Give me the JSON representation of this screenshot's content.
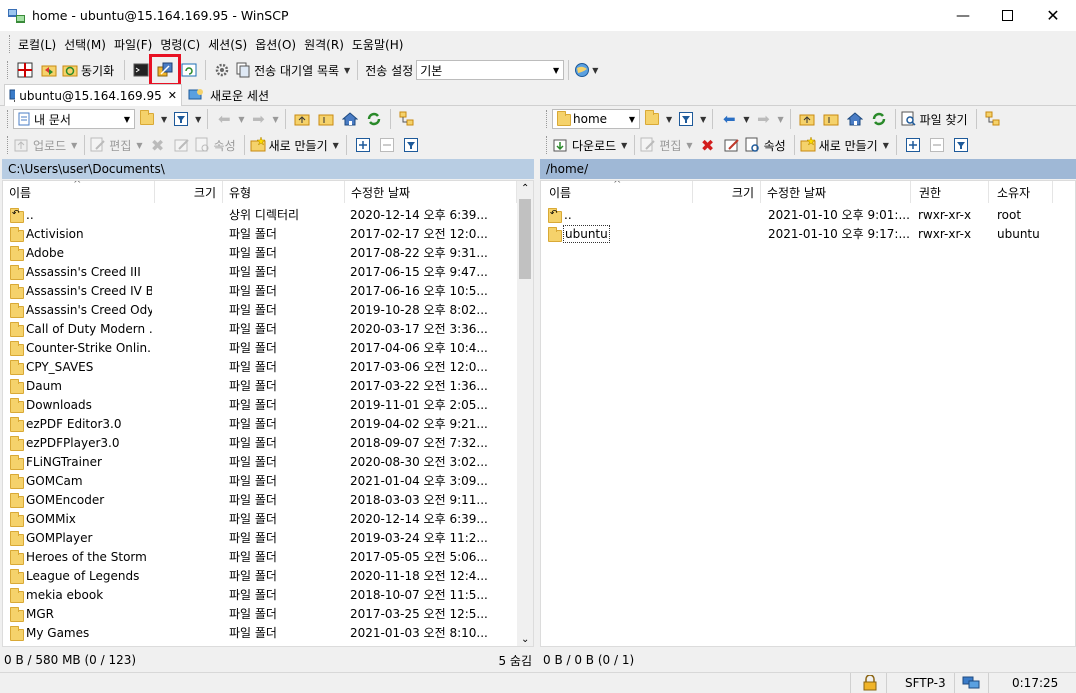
{
  "window": {
    "title": "home - ubuntu@15.164.169.95 - WinSCP"
  },
  "menu": [
    "로컬(L)",
    "선택(M)",
    "파일(F)",
    "명령(C)",
    "세션(S)",
    "옵션(O)",
    "원격(R)",
    "도움말(H)"
  ],
  "toolbar": {
    "sync_label": "동기화",
    "queue_label": "전송 대기열 목록",
    "transfer_settings_label": "전송 설정",
    "transfer_settings_value": "기본"
  },
  "tabs": {
    "session": "ubuntu@15.164.169.95",
    "new_session": "새로운 세션"
  },
  "left": {
    "location": "내 문서",
    "upload_label": "업로드",
    "edit_label": "편집",
    "properties_label": "속성",
    "new_label": "새로 만들기",
    "path": "C:\\Users\\user\\Documents\\",
    "columns": {
      "name": "이름",
      "size": "크기",
      "type": "유형",
      "modified": "수정한 날짜"
    },
    "files": [
      {
        "name": "..",
        "type": "상위 디렉터리",
        "modified": "2020-12-14  오후 6:39...",
        "parent": true
      },
      {
        "name": "Activision",
        "type": "파일 폴더",
        "modified": "2017-02-17  오전 12:0..."
      },
      {
        "name": "Adobe",
        "type": "파일 폴더",
        "modified": "2017-08-22  오후 9:31..."
      },
      {
        "name": "Assassin's Creed III",
        "type": "파일 폴더",
        "modified": "2017-06-15  오후 9:47..."
      },
      {
        "name": "Assassin's Creed IV B...",
        "type": "파일 폴더",
        "modified": "2017-06-16  오후 10:5..."
      },
      {
        "name": "Assassin's Creed Ody...",
        "type": "파일 폴더",
        "modified": "2019-10-28  오후 8:02..."
      },
      {
        "name": "Call of Duty Modern ...",
        "type": "파일 폴더",
        "modified": "2020-03-17  오전 3:36..."
      },
      {
        "name": "Counter-Strike Onlin...",
        "type": "파일 폴더",
        "modified": "2017-04-06  오후 10:4..."
      },
      {
        "name": "CPY_SAVES",
        "type": "파일 폴더",
        "modified": "2017-03-06  오전 12:0..."
      },
      {
        "name": "Daum",
        "type": "파일 폴더",
        "modified": "2017-03-22  오전 1:36..."
      },
      {
        "name": "Downloads",
        "type": "파일 폴더",
        "modified": "2019-11-01  오후 2:05..."
      },
      {
        "name": "ezPDF Editor3.0",
        "type": "파일 폴더",
        "modified": "2019-04-02  오후 9:21..."
      },
      {
        "name": "ezPDFPlayer3.0",
        "type": "파일 폴더",
        "modified": "2018-09-07  오전 7:32..."
      },
      {
        "name": "FLiNGTrainer",
        "type": "파일 폴더",
        "modified": "2020-08-30  오전 3:02..."
      },
      {
        "name": "GOMCam",
        "type": "파일 폴더",
        "modified": "2021-01-04  오후 3:09..."
      },
      {
        "name": "GOMEncoder",
        "type": "파일 폴더",
        "modified": "2018-03-03  오전 9:11..."
      },
      {
        "name": "GOMMix",
        "type": "파일 폴더",
        "modified": "2020-12-14  오후 6:39..."
      },
      {
        "name": "GOMPlayer",
        "type": "파일 폴더",
        "modified": "2019-03-24  오후 11:2..."
      },
      {
        "name": "Heroes of the Storm",
        "type": "파일 폴더",
        "modified": "2017-05-05  오전 5:06..."
      },
      {
        "name": "League of Legends",
        "type": "파일 폴더",
        "modified": "2020-11-18  오전 12:4..."
      },
      {
        "name": "mekia ebook",
        "type": "파일 폴더",
        "modified": "2018-10-07  오전 11:5..."
      },
      {
        "name": "MGR",
        "type": "파일 폴더",
        "modified": "2017-03-25  오전 12:5..."
      },
      {
        "name": "My Games",
        "type": "파일 폴더",
        "modified": "2021-01-03  오전 8:10..."
      }
    ],
    "status_left": "0 B / 580 MB (0 / 123)",
    "status_right": "5 숨김"
  },
  "right": {
    "location": "home",
    "download_label": "다운로드",
    "edit_label": "편집",
    "properties_label": "속성",
    "new_label": "새로 만들기",
    "find_label": "파일 찾기",
    "path": "/home/",
    "columns": {
      "name": "이름",
      "size": "크기",
      "modified": "수정한 날짜",
      "rights": "권한",
      "owner": "소유자"
    },
    "files": [
      {
        "name": "..",
        "modified": "2021-01-10  오후 9:01:...",
        "rights": "rwxr-xr-x",
        "owner": "root",
        "parent": true
      },
      {
        "name": "ubuntu",
        "modified": "2021-01-10  오후 9:17:...",
        "rights": "rwxr-xr-x",
        "owner": "ubuntu"
      }
    ],
    "status": "0 B / 0 B (0 / 1)"
  },
  "bottom": {
    "protocol": "SFTP-3",
    "time": "0:17:25"
  },
  "colors": {
    "left_path_bg": "#b8cde3",
    "right_path_bg": "#9fb8d6",
    "highlight": "#e81123"
  }
}
